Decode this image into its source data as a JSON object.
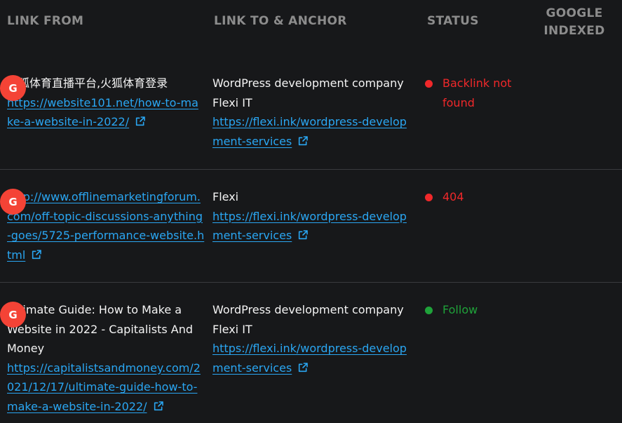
{
  "header": {
    "link_from": "LINK FROM",
    "link_to_anchor": "LINK TO & ANCHOR",
    "status": "STATUS",
    "google_indexed_line1": "GOOGLE",
    "google_indexed_line2": "INDEXED"
  },
  "colors": {
    "link": "#2aa6f2",
    "status_error": "#f0282a",
    "status_ok": "#1fa23a",
    "google_badge": "#f44336"
  },
  "rows": [
    {
      "from_title": "火狐体育直播平台,火狐体育登录",
      "from_url": "https://website101.net/how-to-make-a-website-in-2022/",
      "anchor": "WordPress development company Flexi IT",
      "to_url": "https://flexi.ink/wordpress-development-services",
      "status": "Backlink not found",
      "status_color": "#f0282a",
      "google_letter": "G"
    },
    {
      "from_title": "",
      "from_url": "http://www.offlinemarketingforum.com/off-topic-discussions-anything-goes/5725-performance-website.html",
      "anchor": "Flexi",
      "to_url": "https://flexi.ink/wordpress-development-services",
      "status": "404",
      "status_color": "#f0282a",
      "google_letter": "G"
    },
    {
      "from_title": "Ultimate Guide: How to Make a Website in 2022 - Capitalists And Money",
      "from_url": "https://capitalistsandmoney.com/2021/12/17/ultimate-guide-how-to-make-a-website-in-2022/",
      "anchor": "WordPress development company Flexi IT",
      "to_url": "https://flexi.ink/wordpress-development-services",
      "status": "Follow",
      "status_color": "#1fa23a",
      "google_letter": "G"
    }
  ]
}
